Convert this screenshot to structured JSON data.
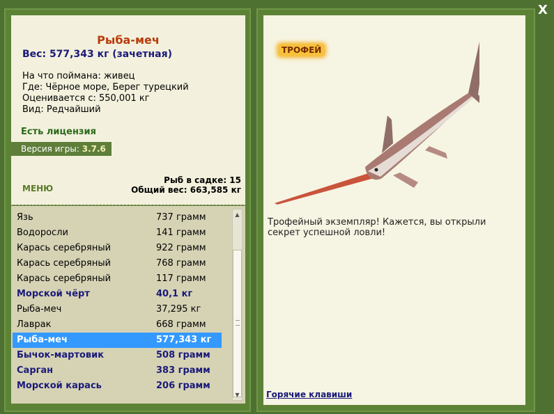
{
  "fish_card": {
    "title": "Рыба-меч",
    "weight_line": "Вес: 577,343 кг (зачетная)",
    "details": [
      "На что поймана: живец",
      "Где: Чёрное море, Берег турецкий",
      "Оценивается с: 550,001 кг",
      "Вид: Редчайший"
    ],
    "license": "Есть лицензия",
    "version_label": "Версия игры:",
    "version_value": "3.7.6",
    "menu_label": "МЕНЮ",
    "stats_count": "Рыб в садке: 15",
    "stats_total": "Общий вес: 663,585 кг"
  },
  "catch_list": [
    {
      "name": "Язь",
      "weight": "737 грамм",
      "style": "normal"
    },
    {
      "name": "Водоросли",
      "weight": "141 грамм",
      "style": "normal"
    },
    {
      "name": "Карась серебряный",
      "weight": "922 грамм",
      "style": "normal"
    },
    {
      "name": "Карась серебряный",
      "weight": "768 грамм",
      "style": "normal"
    },
    {
      "name": "Карась серебряный",
      "weight": "117 грамм",
      "style": "normal"
    },
    {
      "name": "Морской чёрт",
      "weight": "40,1 кг",
      "style": "bold"
    },
    {
      "name": "Рыба-меч",
      "weight": "37,295 кг",
      "style": "normal"
    },
    {
      "name": "Лаврак",
      "weight": "668 грамм",
      "style": "normal"
    },
    {
      "name": "Рыба-меч",
      "weight": "577,343 кг",
      "style": "selected"
    },
    {
      "name": "Бычок-мартовик",
      "weight": "508 грамм",
      "style": "bold"
    },
    {
      "name": "Сарган",
      "weight": "383 грамм",
      "style": "bold"
    },
    {
      "name": "Морской карась",
      "weight": "206 грамм",
      "style": "bold"
    }
  ],
  "detail_panel": {
    "badge": "ТРОФЕЙ",
    "description": "Трофейный экземпляр! Кажется, вы открыли секрет успешной ловли!",
    "hotkeys": "Горячие клавиши",
    "fish_image": "swordfish-illustration"
  },
  "close_label": "X"
}
